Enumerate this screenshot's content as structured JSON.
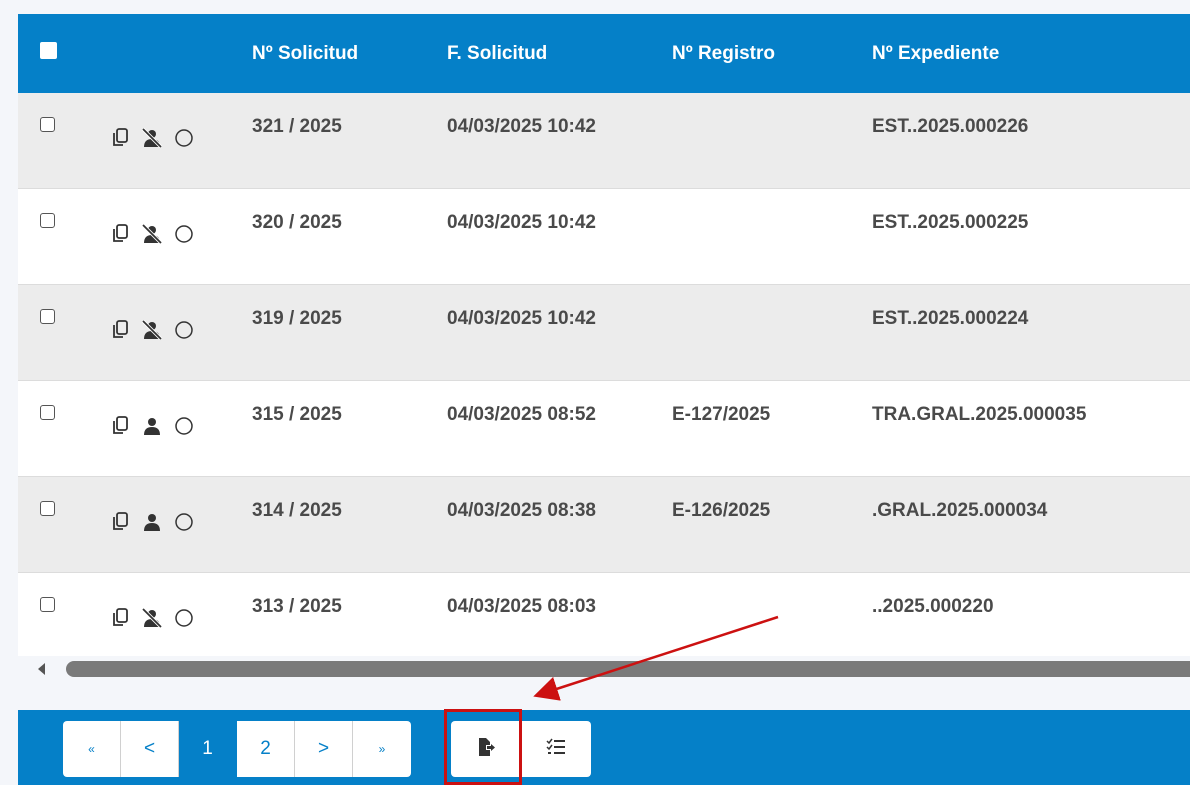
{
  "table": {
    "columns": [
      "Nº Solicitud",
      "F. Solicitud",
      "Nº Registro",
      "Nº Expediente"
    ],
    "rows": [
      {
        "solicitud": "321 / 2025",
        "fecha": "04/03/2025 10:42",
        "registro": "",
        "expediente": "EST..2025.000226",
        "person_icon": "person-off-icon"
      },
      {
        "solicitud": "320 / 2025",
        "fecha": "04/03/2025 10:42",
        "registro": "",
        "expediente": "EST..2025.000225",
        "person_icon": "person-off-icon"
      },
      {
        "solicitud": "319 / 2025",
        "fecha": "04/03/2025 10:42",
        "registro": "",
        "expediente": "EST..2025.000224",
        "person_icon": "person-off-icon"
      },
      {
        "solicitud": "315 / 2025",
        "fecha": "04/03/2025 08:52",
        "registro": "E-127/2025",
        "expediente": "TRA.GRAL.2025.000035",
        "person_icon": "person-icon"
      },
      {
        "solicitud": "314 / 2025",
        "fecha": "04/03/2025 08:38",
        "registro": "E-126/2025",
        "expediente": ".GRAL.2025.000034",
        "person_icon": "person-icon"
      },
      {
        "solicitud": "313 / 2025",
        "fecha": "04/03/2025 08:03",
        "registro": "",
        "expediente": "..2025.000220",
        "person_icon": "person-off-icon"
      }
    ]
  },
  "pager": {
    "first": "«",
    "prev": "<",
    "pages": [
      "1",
      "2"
    ],
    "current_page": "1",
    "next": ">",
    "last": "»"
  },
  "toolbar": {
    "export_icon": "file-export-icon",
    "checklist_icon": "checklist-icon"
  },
  "colors": {
    "header_blue": "#0580c8",
    "highlight_red": "#cc1111"
  }
}
